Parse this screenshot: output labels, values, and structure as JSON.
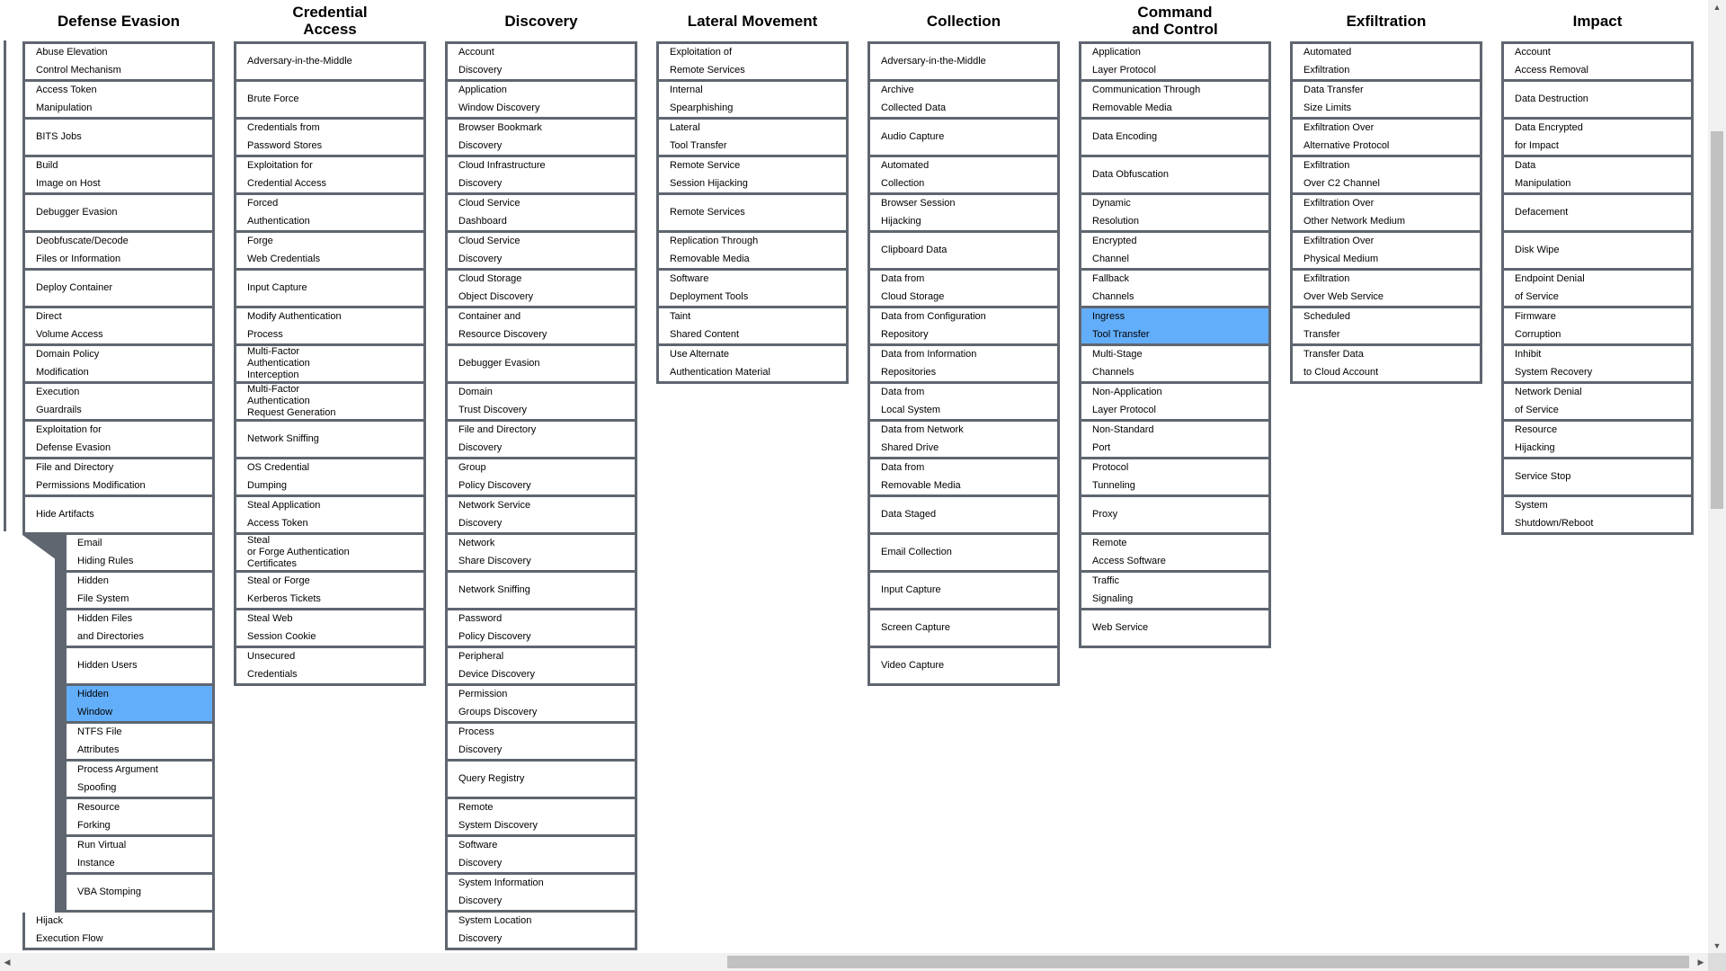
{
  "columns": [
    {
      "title": "Defense Evasion",
      "items": [
        {
          "label": "Abuse Elevation\nControl Mechanism"
        },
        {
          "label": "Access Token\nManipulation"
        },
        {
          "label": "BITS Jobs"
        },
        {
          "label": "Build\nImage on Host"
        },
        {
          "label": "Debugger Evasion"
        },
        {
          "label": "Deobfuscate/Decode\nFiles or Information"
        },
        {
          "label": "Deploy Container"
        },
        {
          "label": "Direct\nVolume Access"
        },
        {
          "label": "Domain Policy\nModification"
        },
        {
          "label": "Execution\nGuardrails"
        },
        {
          "label": "Exploitation for\nDefense Evasion"
        },
        {
          "label": "File and Directory\nPermissions Modification"
        },
        {
          "label": "Hide Artifacts"
        },
        {
          "label": "Hijack\nExecution Flow"
        }
      ],
      "subitems": [
        {
          "label": "Email\nHiding Rules"
        },
        {
          "label": "Hidden\nFile System"
        },
        {
          "label": "Hidden Files\nand Directories"
        },
        {
          "label": "Hidden Users"
        },
        {
          "label": "Hidden\nWindow",
          "selected": true
        },
        {
          "label": "NTFS File\nAttributes"
        },
        {
          "label": "Process Argument\nSpoofing"
        },
        {
          "label": "Resource\nForking"
        },
        {
          "label": "Run Virtual\nInstance"
        },
        {
          "label": "VBA Stomping"
        }
      ]
    },
    {
      "title": "Credential\nAccess",
      "items": [
        {
          "label": "Adversary-in-the-Middle"
        },
        {
          "label": "Brute Force"
        },
        {
          "label": "Credentials from\nPassword Stores"
        },
        {
          "label": "Exploitation for\nCredential Access"
        },
        {
          "label": "Forced\nAuthentication"
        },
        {
          "label": "Forge\nWeb Credentials"
        },
        {
          "label": "Input Capture"
        },
        {
          "label": "Modify Authentication\nProcess"
        },
        {
          "label": "Multi-Factor\nAuthentication\nInterception",
          "dense": true
        },
        {
          "label": "Multi-Factor\nAuthentication\nRequest Generation",
          "dense": true
        },
        {
          "label": "Network Sniffing"
        },
        {
          "label": "OS Credential\nDumping"
        },
        {
          "label": "Steal Application\nAccess Token"
        },
        {
          "label": "Steal\nor Forge Authentication\nCertificates",
          "dense": true
        },
        {
          "label": "Steal or Forge\nKerberos Tickets"
        },
        {
          "label": "Steal Web\nSession Cookie"
        },
        {
          "label": "Unsecured\nCredentials"
        }
      ]
    },
    {
      "title": "Discovery",
      "items": [
        {
          "label": "Account\nDiscovery"
        },
        {
          "label": "Application\nWindow Discovery"
        },
        {
          "label": "Browser Bookmark\nDiscovery"
        },
        {
          "label": "Cloud Infrastructure\nDiscovery"
        },
        {
          "label": "Cloud Service\nDashboard"
        },
        {
          "label": "Cloud Service\nDiscovery"
        },
        {
          "label": "Cloud Storage\nObject Discovery"
        },
        {
          "label": "Container and\nResource Discovery"
        },
        {
          "label": "Debugger Evasion"
        },
        {
          "label": "Domain\nTrust Discovery"
        },
        {
          "label": "File and Directory\nDiscovery"
        },
        {
          "label": "Group\nPolicy Discovery"
        },
        {
          "label": "Network Service\nDiscovery"
        },
        {
          "label": "Network\nShare Discovery"
        },
        {
          "label": "Network Sniffing"
        },
        {
          "label": "Password\nPolicy Discovery"
        },
        {
          "label": "Peripheral\nDevice Discovery"
        },
        {
          "label": "Permission\nGroups Discovery"
        },
        {
          "label": "Process\nDiscovery"
        },
        {
          "label": "Query Registry"
        },
        {
          "label": "Remote\nSystem Discovery"
        },
        {
          "label": "Software\nDiscovery"
        },
        {
          "label": "System Information\nDiscovery"
        },
        {
          "label": "System Location\nDiscovery"
        }
      ]
    },
    {
      "title": "Lateral Movement",
      "items": [
        {
          "label": "Exploitation of\nRemote Services"
        },
        {
          "label": "Internal\nSpearphishing"
        },
        {
          "label": "Lateral\nTool Transfer"
        },
        {
          "label": "Remote Service\nSession Hijacking"
        },
        {
          "label": "Remote Services"
        },
        {
          "label": "Replication Through\nRemovable Media"
        },
        {
          "label": "Software\nDeployment Tools"
        },
        {
          "label": "Taint\nShared Content"
        },
        {
          "label": "Use Alternate\nAuthentication Material"
        }
      ]
    },
    {
      "title": "Collection",
      "items": [
        {
          "label": "Adversary-in-the-Middle"
        },
        {
          "label": "Archive\nCollected Data"
        },
        {
          "label": "Audio Capture"
        },
        {
          "label": "Automated\nCollection"
        },
        {
          "label": "Browser Session\nHijacking"
        },
        {
          "label": "Clipboard Data"
        },
        {
          "label": "Data from\nCloud Storage"
        },
        {
          "label": "Data from Configuration\nRepository"
        },
        {
          "label": "Data from Information\nRepositories"
        },
        {
          "label": "Data from\nLocal System"
        },
        {
          "label": "Data from Network\nShared Drive"
        },
        {
          "label": "Data from\nRemovable Media"
        },
        {
          "label": "Data Staged"
        },
        {
          "label": "Email Collection"
        },
        {
          "label": "Input Capture"
        },
        {
          "label": "Screen Capture"
        },
        {
          "label": "Video Capture"
        }
      ]
    },
    {
      "title": "Command\nand Control",
      "items": [
        {
          "label": "Application\nLayer Protocol"
        },
        {
          "label": "Communication Through\nRemovable Media"
        },
        {
          "label": "Data Encoding"
        },
        {
          "label": "Data Obfuscation"
        },
        {
          "label": "Dynamic\nResolution"
        },
        {
          "label": "Encrypted\nChannel"
        },
        {
          "label": "Fallback\nChannels"
        },
        {
          "label": "Ingress\nTool Transfer",
          "selected": true
        },
        {
          "label": "Multi-Stage\nChannels"
        },
        {
          "label": "Non-Application\nLayer Protocol"
        },
        {
          "label": "Non-Standard\nPort"
        },
        {
          "label": "Protocol\nTunneling"
        },
        {
          "label": "Proxy"
        },
        {
          "label": "Remote\nAccess Software"
        },
        {
          "label": "Traffic\nSignaling"
        },
        {
          "label": "Web Service"
        }
      ]
    },
    {
      "title": "Exfiltration",
      "items": [
        {
          "label": "Automated\nExfiltration"
        },
        {
          "label": "Data Transfer\nSize Limits"
        },
        {
          "label": "Exfiltration Over\nAlternative Protocol"
        },
        {
          "label": "Exfiltration\nOver C2 Channel"
        },
        {
          "label": "Exfiltration Over\nOther Network Medium"
        },
        {
          "label": "Exfiltration Over\nPhysical Medium"
        },
        {
          "label": "Exfiltration\nOver Web Service"
        },
        {
          "label": "Scheduled\nTransfer"
        },
        {
          "label": "Transfer Data\nto Cloud Account"
        }
      ]
    },
    {
      "title": "Impact",
      "items": [
        {
          "label": "Account\nAccess Removal"
        },
        {
          "label": "Data Destruction"
        },
        {
          "label": "Data Encrypted\nfor Impact"
        },
        {
          "label": "Data\nManipulation"
        },
        {
          "label": "Defacement"
        },
        {
          "label": "Disk Wipe"
        },
        {
          "label": "Endpoint Denial\nof Service"
        },
        {
          "label": "Firmware\nCorruption"
        },
        {
          "label": "Inhibit\nSystem Recovery"
        },
        {
          "label": "Network Denial\nof Service"
        },
        {
          "label": "Resource\nHijacking"
        },
        {
          "label": "Service Stop"
        },
        {
          "label": "System\nShutdown/Reboot"
        }
      ]
    }
  ],
  "colors": {
    "border": "#5f6670",
    "selected": "#63aefb"
  }
}
